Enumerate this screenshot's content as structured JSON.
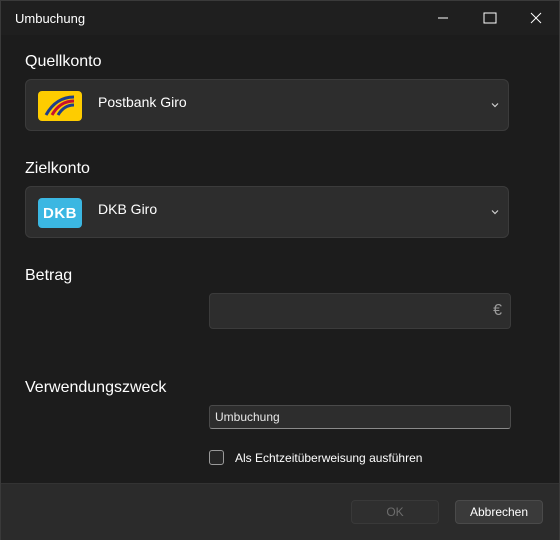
{
  "window": {
    "title": "Umbuchung",
    "controls": {
      "minimize": "minimize-icon",
      "maximize": "maximize-icon",
      "close": "close-icon"
    }
  },
  "source": {
    "label": "Quellkonto",
    "selected": "Postbank Giro",
    "logo": "postbank-logo",
    "logo_color": "#fecc00"
  },
  "target": {
    "label": "Zielkonto",
    "selected": "DKB Giro",
    "logo_text": "DKB",
    "logo_color": "#3bb7e2"
  },
  "amount": {
    "label": "Betrag",
    "value": "",
    "currency": "€"
  },
  "purpose": {
    "label": "Verwendungszweck",
    "value": "Umbuchung"
  },
  "instant": {
    "label": "Als Echtzeitüberweisung ausführen",
    "checked": false
  },
  "buttons": {
    "ok": "OK",
    "cancel": "Abbrechen"
  }
}
